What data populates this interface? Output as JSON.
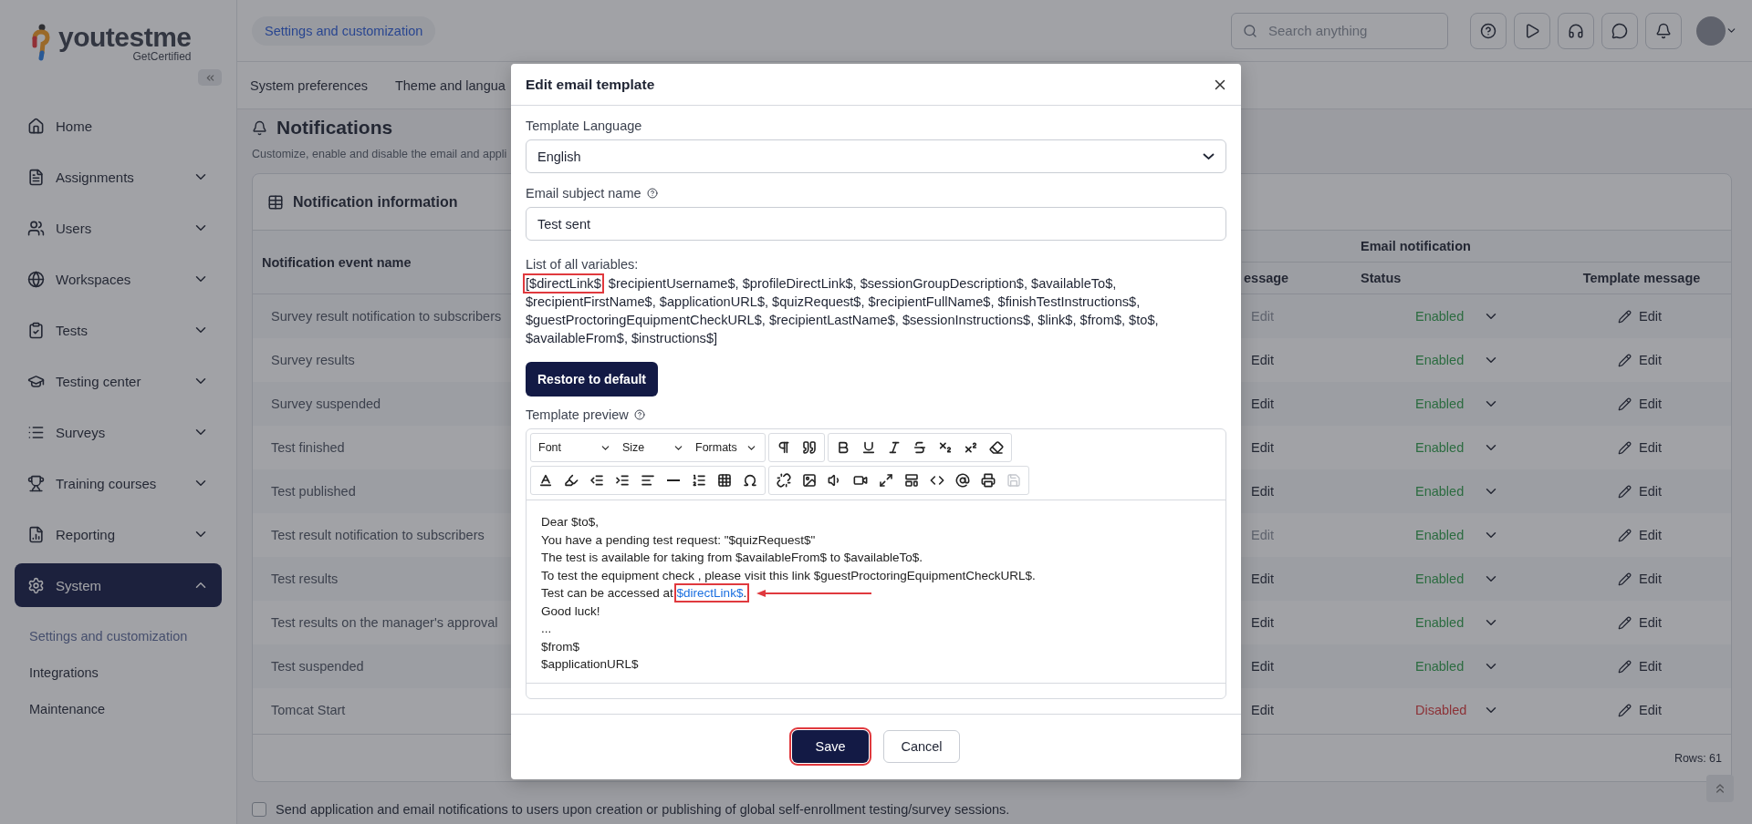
{
  "logo": {
    "name": "youtestme",
    "tagline": "GetCertified"
  },
  "sidebar": {
    "items": [
      {
        "label": "Home",
        "kind": "link",
        "selected": false
      },
      {
        "label": "Assignments",
        "kind": "group",
        "selected": false,
        "expanded": false
      },
      {
        "label": "Users",
        "kind": "group",
        "selected": false,
        "expanded": false
      },
      {
        "label": "Workspaces",
        "kind": "group",
        "selected": false,
        "expanded": false
      },
      {
        "label": "Tests",
        "kind": "group",
        "selected": false,
        "expanded": false
      },
      {
        "label": "Testing center",
        "kind": "group",
        "selected": false,
        "expanded": false
      },
      {
        "label": "Surveys",
        "kind": "group",
        "selected": false,
        "expanded": false
      },
      {
        "label": "Training courses",
        "kind": "group",
        "selected": false,
        "expanded": false
      },
      {
        "label": "Reporting",
        "kind": "group",
        "selected": false,
        "expanded": false
      },
      {
        "label": "System",
        "kind": "group",
        "selected": true,
        "expanded": true,
        "children": [
          {
            "label": "Settings and customization",
            "selected": true
          },
          {
            "label": "Integrations",
            "selected": false
          },
          {
            "label": "Maintenance",
            "selected": false
          }
        ]
      }
    ]
  },
  "topbar": {
    "breadcrumb": "Settings and customization",
    "search": {
      "placeholder": "Search anything"
    }
  },
  "tabs": [
    {
      "label": "System preferences"
    },
    {
      "label": "Theme and langua"
    }
  ],
  "page": {
    "title": "Notifications",
    "description": "Customize, enable and disable the email and appli"
  },
  "card": {
    "title": "Notification information",
    "footer": "Rows: 61"
  },
  "table": {
    "event_header": "Notification event name",
    "group_header": "Email notification",
    "columns": [
      "essage",
      "Status",
      "Template message"
    ],
    "rows": [
      {
        "event": "Survey result notification to subscribers",
        "column_2": "Edit",
        "edit_disabled": true,
        "status": "Enabled",
        "status_on": true,
        "template": "Edit"
      },
      {
        "event": "Survey results",
        "column_2": "Edit",
        "edit_disabled": false,
        "status": "Enabled",
        "status_on": true,
        "template": "Edit"
      },
      {
        "event": "Survey suspended",
        "column_2": "Edit",
        "edit_disabled": false,
        "status": "Enabled",
        "status_on": true,
        "template": "Edit"
      },
      {
        "event": "Test finished",
        "column_2": "Edit",
        "edit_disabled": false,
        "status": "Enabled",
        "status_on": true,
        "template": "Edit"
      },
      {
        "event": "Test published",
        "column_2": "Edit",
        "edit_disabled": false,
        "status": "Enabled",
        "status_on": true,
        "template": "Edit"
      },
      {
        "event": "Test result notification to subscribers",
        "column_2": "Edit",
        "edit_disabled": true,
        "status": "Enabled",
        "status_on": true,
        "template": "Edit"
      },
      {
        "event": "Test results",
        "column_2": "Edit",
        "edit_disabled": false,
        "status": "Enabled",
        "status_on": true,
        "template": "Edit"
      },
      {
        "event": "Test results on the manager's approval",
        "column_2": "Edit",
        "edit_disabled": false,
        "status": "Enabled",
        "status_on": true,
        "template": "Edit"
      },
      {
        "event": "Test suspended",
        "column_2": "Edit",
        "edit_disabled": false,
        "status": "Enabled",
        "status_on": true,
        "template": "Edit"
      },
      {
        "event": "Tomcat Start",
        "column_2": "Edit",
        "edit_disabled": false,
        "status": "Disabled",
        "status_on": false,
        "template": "Edit"
      }
    ]
  },
  "bottom_option": {
    "label": "Send application and email notifications to users upon creation or publishing of global self-enrollment testing/survey sessions.",
    "checked": false
  },
  "modal": {
    "title": "Edit email template",
    "language": {
      "label": "Template Language",
      "value": "English"
    },
    "subject": {
      "label": "Email subject name",
      "value": "Test sent"
    },
    "variables": {
      "label": "List of all variables:",
      "highlighted": "[$directLink$",
      "rest": ", $recipientUsername$, $profileDirectLink$, $sessionGroupDescription$, $availableTo$, $recipientFirstName$, $applicationURL$, $quizRequest$, $recipientFullName$, $finishTestInstructions$, $guestProctoringEquipmentCheckURL$, $recipientLastName$, $sessionInstructions$, $link$, $from$, $to$, $availableFrom$, $instructions$]"
    },
    "restore_button": "Restore to default",
    "preview_label": "Template preview",
    "toolbar": {
      "dropdowns": [
        "Font",
        "Size",
        "Formats"
      ],
      "save_disabled": true
    },
    "editor_lines": [
      {
        "text": "Dear $to$,"
      },
      {
        "text": "You have a pending test request: \"$quizRequest$\""
      },
      {
        "text": "The test is available for taking from $availableFrom$ to $availableTo$."
      },
      {
        "text": "To test the equipment check , please visit this link $guestProctoringEquipmentCheckURL$."
      },
      {
        "text": "Test can be accessed at ",
        "link": "$directLink$",
        "after": ".",
        "highlighted": true
      },
      {
        "text": "Good luck!"
      },
      {
        "text": "..."
      },
      {
        "text": "$from$"
      },
      {
        "text": "$applicationURL$"
      }
    ],
    "buttons": [
      {
        "label": "Save",
        "kind": "primary",
        "highlighted": true
      },
      {
        "label": "Cancel",
        "kind": "secondary",
        "highlighted": false
      }
    ]
  }
}
